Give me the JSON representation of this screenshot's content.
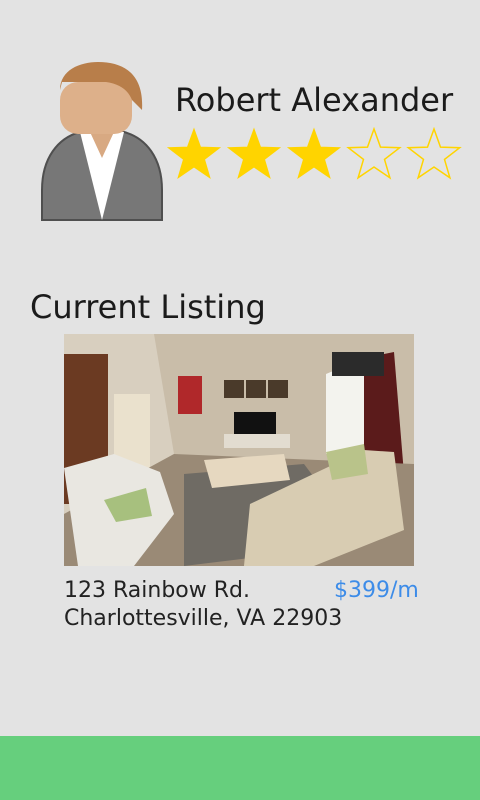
{
  "profile": {
    "name": "Robert Alexander",
    "rating": 3,
    "rating_max": 5
  },
  "listing": {
    "section_title": "Current Listing",
    "address_line1": "123 Rainbow Rd.",
    "address_line2": "Charlottesville, VA 22903",
    "price": "$399/m"
  },
  "icons": {
    "avatar": "person-avatar-icon",
    "star_filled": "star-filled-icon",
    "star_empty": "star-outline-icon"
  },
  "colors": {
    "background": "#e3e3e3",
    "star_fill": "#ffd400",
    "price": "#3d8ce8",
    "bottom_bar": "#66cf7d"
  }
}
